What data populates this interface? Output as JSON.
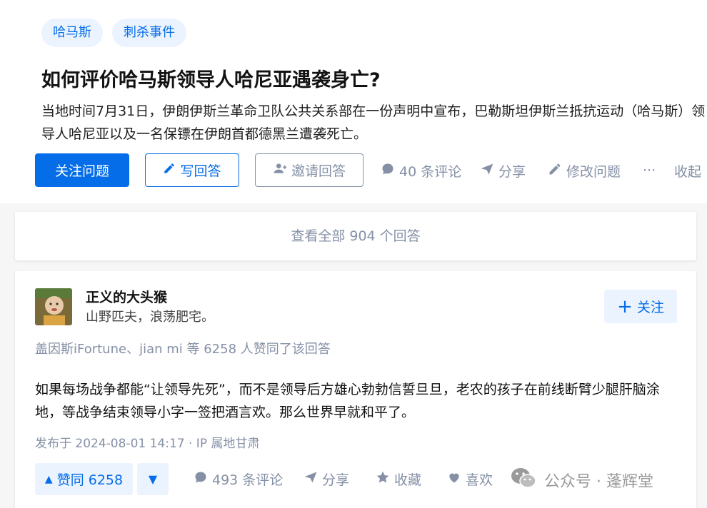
{
  "topics": [
    "哈马斯",
    "刺杀事件"
  ],
  "question": {
    "title": "如何评价哈马斯领导人哈尼亚遇袭身亡?",
    "detail": "当地时间7月31日，伊朗伊斯兰革命卫队公共关系部在一份声明中宣布，巴勒斯坦伊斯兰抵抗运动（哈马斯）领导人哈尼亚以及一名保镖在伊朗首都德黑兰遭袭死亡。"
  },
  "question_actions": {
    "follow": "关注问题",
    "write": "写回答",
    "invite": "邀请回答",
    "comments": "40 条评论",
    "share": "分享",
    "edit": "修改问题",
    "more": "···",
    "collapse": "收起"
  },
  "view_all": "查看全部 904 个回答",
  "answer": {
    "author_name": "正义的大头猴",
    "author_bio": "山野匹夫，浪荡肥宅。",
    "follow": "关注",
    "voters": "盖因斯iFortune、jian mi 等 6258 人赞同了该回答",
    "content": "如果每场战争都能“让领导先死”，而不是领导后方雄心勃勃信誓旦旦，老农的孩子在前线断臂少腿肝脑涂地，等战争结束领导小字一签把酒言欢。那么世界早就和平了。",
    "time": "发布于 2024-08-01 14:17 · IP 属地甘肃",
    "vote_up": "赞同 6258",
    "comments": "493 条评论",
    "share": "分享",
    "favorite": "收藏",
    "like": "喜欢"
  },
  "watermark": "公众号 · 蓬辉堂",
  "colors": {
    "brand": "#056de8",
    "brand_light": "#ebf3fe",
    "muted": "#8590a6"
  }
}
